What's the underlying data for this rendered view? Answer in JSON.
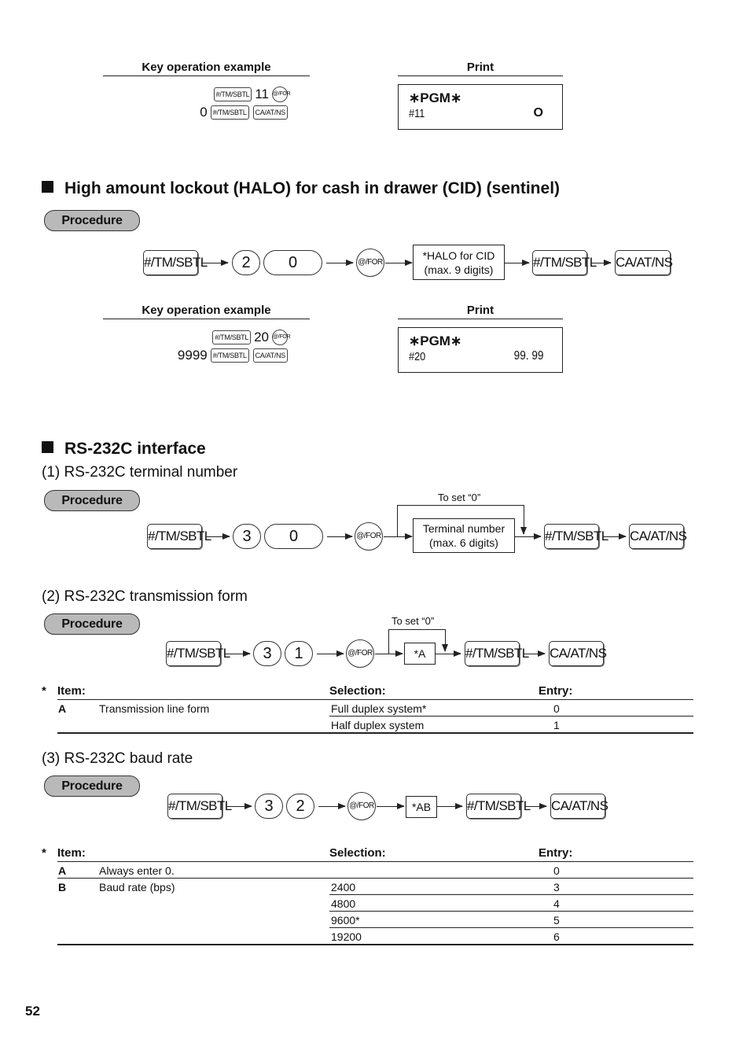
{
  "example1": {
    "key_header": "Key operation example",
    "print_header": "Print",
    "line1": {
      "key_a": "#/TM/SBTL",
      "text": "11",
      "key_b": "@/FOR"
    },
    "line2": {
      "text": "0",
      "key_a": "#/TM/SBTL",
      "key_b": "CA/AT/NS"
    },
    "print": {
      "title": "∗PGM∗",
      "code": "#11",
      "value": "O"
    }
  },
  "halo": {
    "title": "High amount lockout (HALO) for cash in drawer (CID) (sentinel)",
    "procedure_label": "Procedure",
    "flow": {
      "key1": "#/TM/SBTL",
      "digit1": "2",
      "digit2": "0",
      "key2": "@/FOR",
      "box_line1": "*HALO for CID",
      "box_line2": "(max. 9 digits)",
      "key3": "#/TM/SBTL",
      "key4": "CA/AT/NS"
    },
    "example": {
      "key_header": "Key operation example",
      "print_header": "Print",
      "line1": {
        "key_a": "#/TM/SBTL",
        "text": "20",
        "key_b": "@/FOR"
      },
      "line2": {
        "text": "9999",
        "key_a": "#/TM/SBTL",
        "key_b": "CA/AT/NS"
      },
      "print": {
        "title": "∗PGM∗",
        "code": "#20",
        "value": "99. 99"
      }
    }
  },
  "rs232c": {
    "title": "RS-232C interface",
    "terminal": {
      "subtitle": "(1) RS-232C terminal number",
      "procedure_label": "Procedure",
      "loop_label": "To set “0”",
      "flow": {
        "key1": "#/TM/SBTL",
        "digit1": "3",
        "digit2": "0",
        "key2": "@/FOR",
        "box_line1": "Terminal number",
        "box_line2": "(max. 6 digits)",
        "key3": "#/TM/SBTL",
        "key4": "CA/AT/NS"
      }
    },
    "transmission": {
      "subtitle": "(2) RS-232C transmission form",
      "procedure_label": "Procedure",
      "loop_label": "To set “0”",
      "flow": {
        "key1": "#/TM/SBTL",
        "digit1": "3",
        "digit2": "1",
        "key2": "@/FOR",
        "box": "*A",
        "key3": "#/TM/SBTL",
        "key4": "CA/AT/NS"
      },
      "table": {
        "star": "*",
        "headers": {
          "item": "Item:",
          "selection": "Selection:",
          "entry": "Entry:"
        },
        "rows": [
          {
            "code": "A",
            "item": "Transmission line form",
            "selection": "Full duplex system*",
            "entry": "0"
          },
          {
            "code": "",
            "item": "",
            "selection": "Half duplex system",
            "entry": "1"
          }
        ]
      }
    },
    "baud": {
      "subtitle": "(3) RS-232C baud rate",
      "procedure_label": "Procedure",
      "flow": {
        "key1": "#/TM/SBTL",
        "digit1": "3",
        "digit2": "2",
        "key2": "@/FOR",
        "box": "*AB",
        "key3": "#/TM/SBTL",
        "key4": "CA/AT/NS"
      },
      "table": {
        "star": "*",
        "headers": {
          "item": "Item:",
          "selection": "Selection:",
          "entry": "Entry:"
        },
        "rows": [
          {
            "code": "A",
            "item": "Always enter 0.",
            "selection": "",
            "entry": "0"
          },
          {
            "code": "B",
            "item": "Baud rate (bps)",
            "selection": "2400",
            "entry": "3"
          },
          {
            "code": "",
            "item": "",
            "selection": "4800",
            "entry": "4"
          },
          {
            "code": "",
            "item": "",
            "selection": "9600*",
            "entry": "5"
          },
          {
            "code": "",
            "item": "",
            "selection": "19200",
            "entry": "6"
          }
        ]
      }
    }
  },
  "page_number": "52"
}
